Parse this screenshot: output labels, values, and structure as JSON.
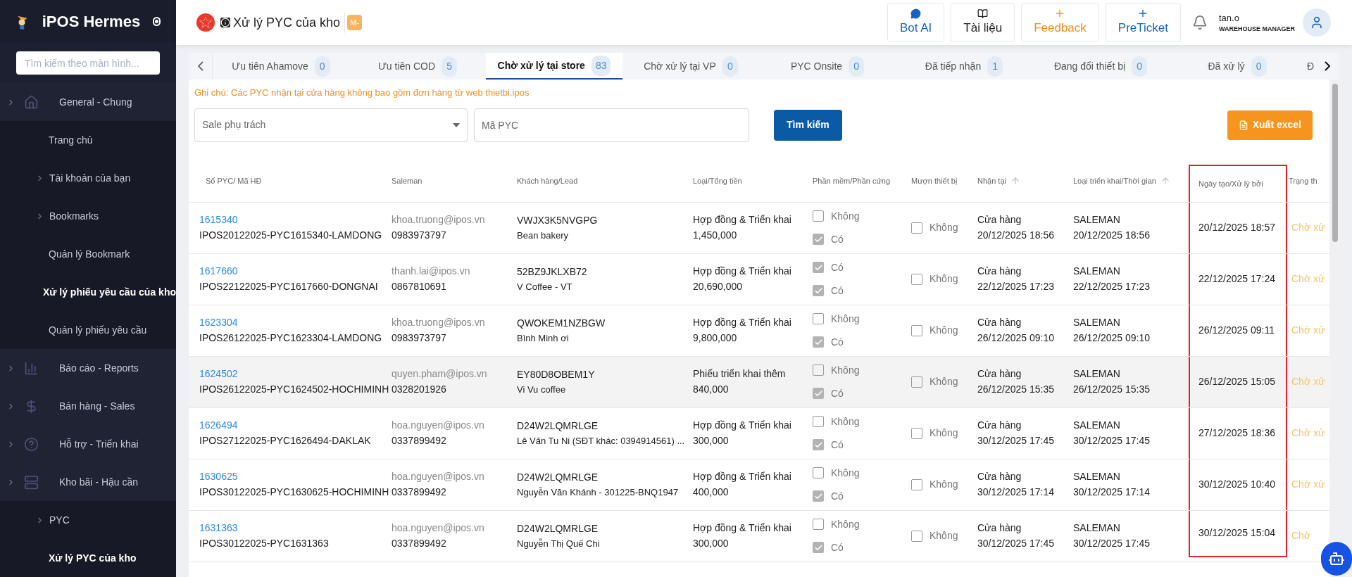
{
  "sidebar": {
    "brand": "iPOS Hermes",
    "search_placeholder": "Tìm kiếm theo màn hình...",
    "groups": [
      {
        "label": "General - Chung",
        "children": [
          {
            "label": "Trang chủ",
            "kind": "link",
            "selected": false
          },
          {
            "label": "Tài khoản của bạn",
            "kind": "folder",
            "selected": false
          },
          {
            "label": "Bookmarks",
            "kind": "folder",
            "selected": false
          },
          {
            "label": "Quản lý Bookmark",
            "kind": "link",
            "selected": false
          },
          {
            "label": "Xử lý phiếu yêu cầu của kho",
            "kind": "link",
            "selected": true
          },
          {
            "label": "Quản lý phiếu yêu cầu",
            "kind": "link",
            "selected": false
          }
        ]
      },
      {
        "label": "Báo cáo - Reports"
      },
      {
        "label": "Bán hàng - Sales"
      },
      {
        "label": "Hỗ trợ - Triển khai"
      },
      {
        "label": "Kho bãi - Hậu cần",
        "children": [
          {
            "label": "PYC",
            "kind": "folder",
            "selected": false
          },
          {
            "label": "Xử lý PYC của kho",
            "kind": "link",
            "selected": true
          }
        ]
      }
    ]
  },
  "header": {
    "title": "Xử lý PYC của kho",
    "badge": "M-",
    "actions": [
      {
        "label": "Bot AI",
        "kind": "chat"
      },
      {
        "label": "Tài liệu",
        "kind": "docs"
      },
      {
        "label": "Feedback",
        "kind": "plus-orange"
      },
      {
        "label": "PreTicket",
        "kind": "plus-blue"
      }
    ],
    "user": {
      "name": "tan.o",
      "role": "WAREHOUSE MANAGER"
    }
  },
  "tabs": [
    {
      "label": "Ưu tiên Ahamove",
      "count": "0",
      "selected": false
    },
    {
      "label": "Ưu tiên COD",
      "count": "5",
      "selected": false
    },
    {
      "label": "Chờ xử lý tại store",
      "count": "83",
      "selected": true
    },
    {
      "label": "Chờ xử lý tại VP",
      "count": "0",
      "selected": false
    },
    {
      "label": "PYC Onsite",
      "count": "0",
      "selected": false
    },
    {
      "label": "Đã tiếp nhận",
      "count": "1",
      "selected": false
    },
    {
      "label": "Đang đổi thiết bị",
      "count": "0",
      "selected": false
    },
    {
      "label": "Đã xử lý",
      "count": "0",
      "selected": false
    },
    {
      "label": "Đ",
      "selected": false
    }
  ],
  "note": "Ghi chú: Các PYC nhận tại cửa hàng không bao gồm đơn hàng từ web thietbi.ipos",
  "filters": {
    "sale_placeholder": "Sale phụ trách",
    "code_placeholder": "Mã PYC",
    "search_button": "Tìm kiếm",
    "export_button": "Xuất excel"
  },
  "table": {
    "columns": [
      {
        "label": "Số PYC/ Mã HĐ",
        "sortable": false,
        "highlighted": false
      },
      {
        "label": "Saleman",
        "sortable": false,
        "highlighted": false
      },
      {
        "label": "Khách hàng/Lead",
        "sortable": false,
        "highlighted": false
      },
      {
        "label": "Loại/Tổng tiền",
        "sortable": false,
        "highlighted": false
      },
      {
        "label": "Phần mềm/Phần cứng",
        "sortable": false,
        "highlighted": false
      },
      {
        "label": "Mượn thiết bị",
        "sortable": false,
        "highlighted": false
      },
      {
        "label": "Nhận tại",
        "sortable": true,
        "highlighted": false
      },
      {
        "label": "Loại triển khai/Thời gian",
        "sortable": true,
        "highlighted": false
      },
      {
        "label": "Ngày tạo/Xử lý bởi",
        "sortable": false,
        "highlighted": true
      },
      {
        "label": "Trạng th",
        "sortable": false,
        "highlighted": false
      }
    ],
    "rows": [
      {
        "id": "1615340",
        "contract": "IPOS20122025-PYC1615340-LAMDONG",
        "email": "khoa.truong@ipos.vn",
        "phone": "0983973797",
        "lead": "VWJX3K5NVGPG",
        "customer": "Bean bakery",
        "type": "Hợp đồng & Triển khai",
        "total": "1,450,000",
        "software": [
          {
            "label": "Không",
            "checked": false
          },
          {
            "label": "Có",
            "checked": true
          }
        ],
        "borrow": {
          "label": "Không",
          "checked": false
        },
        "received": "Cửa hàng",
        "received_time": "20/12/2025 18:56",
        "deploy": "SALEMAN",
        "deploy_time": "20/12/2025 18:56",
        "created": "20/12/2025 18:57",
        "status": "Chờ xử",
        "highlighted": false
      },
      {
        "id": "1617660",
        "contract": "IPOS22122025-PYC1617660-DONGNAI",
        "email": "thanh.lai@ipos.vn",
        "phone": "0867810691",
        "lead": "52BZ9JKLXB72",
        "customer": "V Coffee - VT",
        "type": "Hợp đồng & Triển khai",
        "total": "20,690,000",
        "software": [
          {
            "label": "Có",
            "checked": true
          },
          {
            "label": "Có",
            "checked": true
          }
        ],
        "borrow": {
          "label": "Không",
          "checked": false
        },
        "received": "Cửa hàng",
        "received_time": "22/12/2025 17:23",
        "deploy": "SALEMAN",
        "deploy_time": "22/12/2025 17:23",
        "created": "22/12/2025 17:24",
        "status": "Chờ xử",
        "highlighted": false
      },
      {
        "id": "1623304",
        "contract": "IPOS26122025-PYC1623304-LAMDONG",
        "email": "khoa.truong@ipos.vn",
        "phone": "0983973797",
        "lead": "QWOKEM1NZBGW",
        "customer": "Bình Minh ơi",
        "type": "Hợp đồng & Triển khai",
        "total": "9,800,000",
        "software": [
          {
            "label": "Không",
            "checked": false
          },
          {
            "label": "Có",
            "checked": true
          }
        ],
        "borrow": {
          "label": "Không",
          "checked": false
        },
        "received": "Cửa hàng",
        "received_time": "26/12/2025 09:10",
        "deploy": "SALEMAN",
        "deploy_time": "26/12/2025 09:10",
        "created": "26/12/2025 09:11",
        "status": "Chờ xử",
        "highlighted": false
      },
      {
        "id": "1624502",
        "contract": "IPOS26122025-PYC1624502-HOCHIMINH",
        "email": "quyen.pham@ipos.vn",
        "phone": "0328201926",
        "lead": "EY80D8OBEM1Y",
        "customer": "Vi Vu coffee",
        "type": "Phiếu triển khai thêm",
        "total": "840,000",
        "software": [
          {
            "label": "Không",
            "checked": false
          },
          {
            "label": "Có",
            "checked": true
          }
        ],
        "borrow": {
          "label": "Không",
          "checked": false
        },
        "received": "Cửa hàng",
        "received_time": "26/12/2025 15:35",
        "deploy": "SALEMAN",
        "deploy_time": "26/12/2025 15:35",
        "created": "26/12/2025 15:05",
        "status": "Chờ xử",
        "highlighted": true
      },
      {
        "id": "1626494",
        "contract": "IPOS27122025-PYC1626494-DAKLAK",
        "email": "hoa.nguyen@ipos.vn",
        "phone": "0337899492",
        "lead": "D24W2LQMRLGE",
        "customer": "Lê Văn Tu Ni (SĐT khác: 0394914561) ...",
        "type": "Hợp đồng & Triển khai",
        "total": "300,000",
        "software": [
          {
            "label": "Không",
            "checked": false
          },
          {
            "label": "Có",
            "checked": true
          }
        ],
        "borrow": {
          "label": "Không",
          "checked": false
        },
        "received": "Cửa hàng",
        "received_time": "30/12/2025 17:45",
        "deploy": "SALEMAN",
        "deploy_time": "30/12/2025 17:45",
        "created": "27/12/2025 18:36",
        "status": "Chờ xử",
        "highlighted": false
      },
      {
        "id": "1630625",
        "contract": "IPOS30122025-PYC1630625-HOCHIMINH",
        "email": "hoa.nguyen@ipos.vn",
        "phone": "0337899492",
        "lead": "D24W2LQMRLGE",
        "customer": "Nguyễn Văn Khánh - 301225-BNQ1947",
        "type": "Hợp đồng & Triển khai",
        "total": "400,000",
        "software": [
          {
            "label": "Không",
            "checked": false
          },
          {
            "label": "Có",
            "checked": true
          }
        ],
        "borrow": {
          "label": "Không",
          "checked": false
        },
        "received": "Cửa hàng",
        "received_time": "30/12/2025 17:14",
        "deploy": "SALEMAN",
        "deploy_time": "30/12/2025 17:14",
        "created": "30/12/2025 10:40",
        "status": "Chờ xử",
        "highlighted": false
      },
      {
        "id": "1631363",
        "contract": "IPOS30122025-PYC1631363",
        "email": "hoa.nguyen@ipos.vn",
        "phone": "0337899492",
        "lead": "D24W2LQMRLGE",
        "customer": "Nguyễn Thị Quế Chi",
        "type": "Hợp đồng & Triển khai",
        "total": "300,000",
        "software": [
          {
            "label": "Không",
            "checked": false
          },
          {
            "label": "Có",
            "checked": true
          }
        ],
        "borrow": {
          "label": "Không",
          "checked": false
        },
        "received": "Cửa hàng",
        "received_time": "30/12/2025 17:45",
        "deploy": "SALEMAN",
        "deploy_time": "30/12/2025 17:45",
        "created": "30/12/2025 15:04",
        "status": "Chờ",
        "highlighted": false
      }
    ]
  }
}
